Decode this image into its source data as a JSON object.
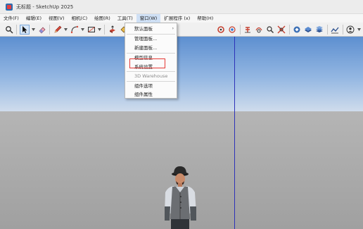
{
  "window": {
    "title": "无标题 - SketchUp 2025"
  },
  "menubar": {
    "items": [
      "文件(F)",
      "编辑(E)",
      "视图(V)",
      "相机(C)",
      "绘图(R)",
      "工具(T)",
      "窗口(W)",
      "扩展程序 (x)",
      "帮助(H)"
    ]
  },
  "window_menu": {
    "items": [
      {
        "label": "默认面板",
        "submenu": "›"
      },
      {
        "label": "管理面板..."
      },
      {
        "label": "新建面板..."
      },
      {
        "label": "模型信息"
      },
      {
        "label": "系统设置"
      },
      {
        "label": "3D Warehouse"
      },
      {
        "label": "组件选项"
      },
      {
        "label": "组件属性"
      }
    ]
  },
  "colors": {
    "accent_select": "#d7e6f7",
    "highlight_box": "#e53935",
    "blue_axis": "#2d31b8"
  }
}
